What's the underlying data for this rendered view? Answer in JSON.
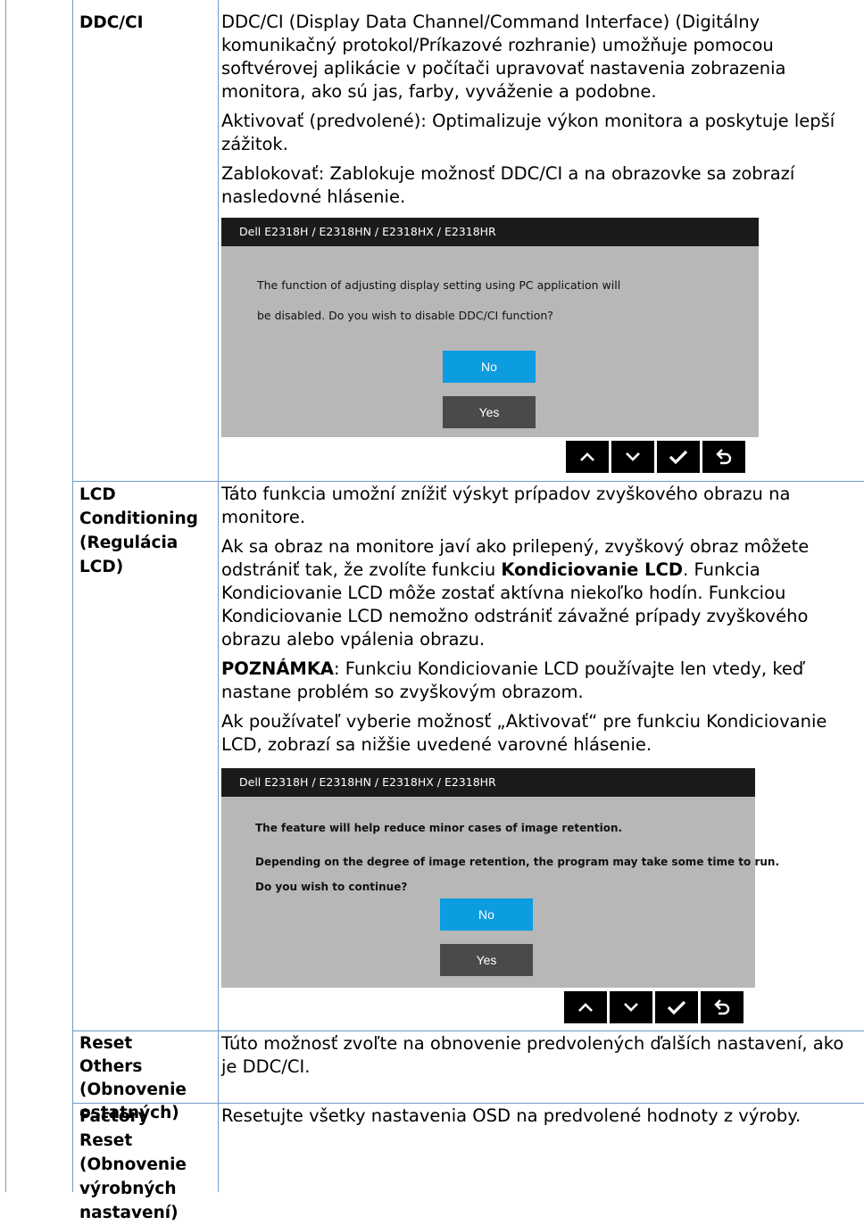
{
  "rows": [
    {
      "label": "DDC/CI",
      "paragraphs": [
        "DDC/CI (Display Data Channel/Command Interface) (Digitálny komunikačný protokol/Príkazové rozhranie) umožňuje pomocou softvérovej aplikácie v počítači upravovať nastavenia zobrazenia monitora, ako sú jas, farby, vyváženie a podobne.",
        "Aktivovať (predvolené): Optimalizuje výkon monitora a poskytuje lepší zážitok.",
        "Zablokovať: Zablokuje možnosť DDC/CI a na obrazovke sa zobrazí nasledovné hlásenie."
      ],
      "dialog": {
        "title": "Dell  E2318H / E2318HN / E2318HX / E2318HR",
        "lines": [
          "The function of adjusting display setting using PC application will",
          "be disabled. Do you wish to disable DDC/CI function?"
        ],
        "no_label": "No",
        "yes_label": "Yes"
      }
    },
    {
      "label": "LCD Conditioning (Regulácia LCD)",
      "p1": "Táto funkcia umožní znížiť výskyt prípadov zvyškového obrazu na monitore.",
      "p2_before": "Ak sa obraz na monitore javí ako prilepený, zvyškový obraz môžete odstrániť tak, že zvolíte funkciu ",
      "p2_bold": "Kondiciovanie LCD",
      "p2_after": ". Funkcia Kondiciovanie LCD môže zostať aktívna niekoľko hodín. Funkciou Kondiciovanie LCD nemožno odstrániť závažné prípady zvyškového obrazu alebo vpálenia obrazu.",
      "note_label": "POZNÁMKA",
      "note_text": ": Funkciu Kondiciovanie LCD používajte len vtedy, keď nastane problém so zvyškovým obrazom.",
      "p4": "Ak používateľ vyberie možnosť „Aktivovať“ pre funkciu Kondiciovanie LCD, zobrazí sa nižšie uvedené varovné hlásenie.",
      "dialog": {
        "title": "Dell  E2318H / E2318HN / E2318HX / E2318HR",
        "lines": [
          "The feature will help reduce minor cases of image retention.",
          "Depending on the degree of image retention, the program may take some time to run.",
          "Do you wish to continue?"
        ],
        "no_label": "No",
        "yes_label": "Yes"
      }
    },
    {
      "label": "Reset Others (Obnovenie ostatných)",
      "text": "Túto možnosť zvoľte na obnovenie predvolených ďalších nastavení, ako je DDC/CI."
    },
    {
      "label": "Factory Reset (Obnovenie výrobných nastavení)",
      "text": "Resetujte všetky nastavenia OSD na predvolené hodnoty z výroby."
    }
  ],
  "nav_icons": [
    "up-arrow-icon",
    "down-arrow-icon",
    "check-icon",
    "back-icon"
  ]
}
